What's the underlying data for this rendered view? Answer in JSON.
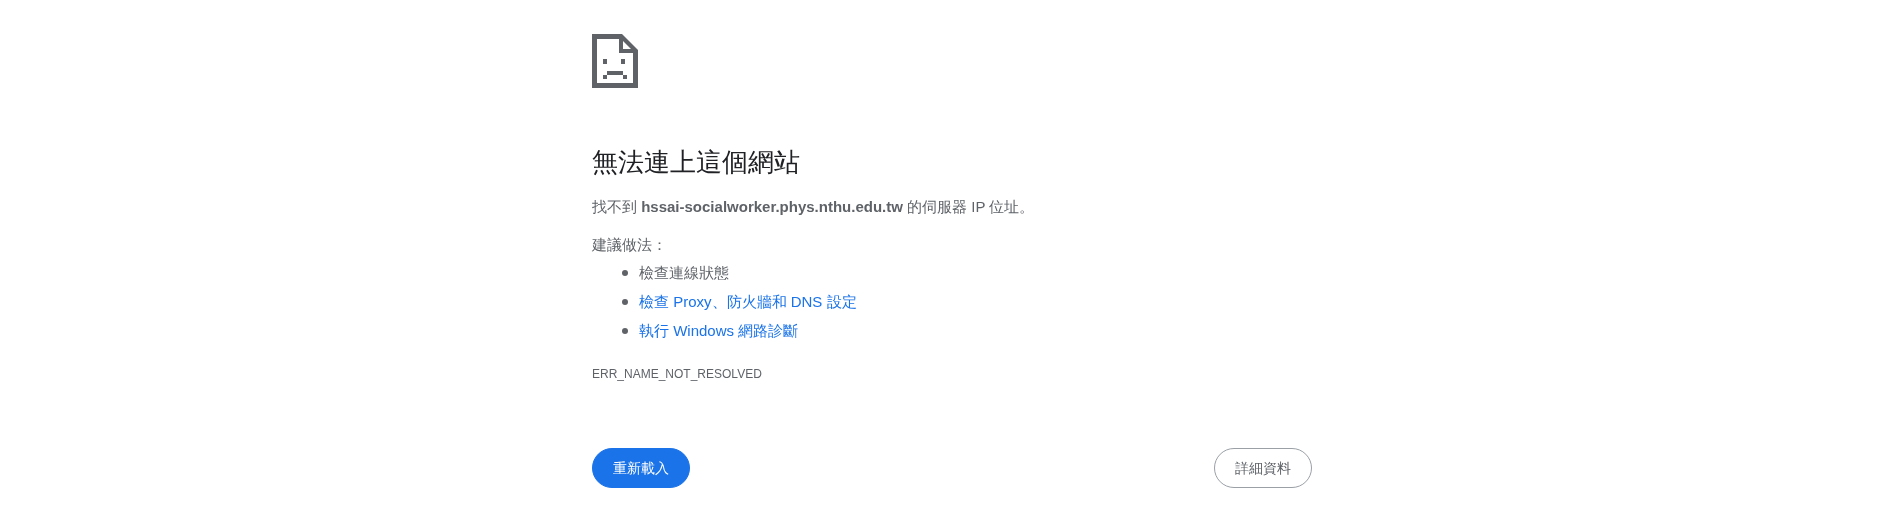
{
  "heading": "無法連上這個網站",
  "message": "找不到 **hssai-socialworker.phys.nthu.edu.tw** 的伺服器 IP 位址。",
  "suggestions_heading": "建議做法：",
  "suggestions": [
    {
      "kind": "text",
      "label": "檢查連線狀態"
    },
    {
      "kind": "link",
      "label": "檢查 Proxy、防火牆和 DNS 設定"
    },
    {
      "kind": "link",
      "label": "執行 Windows 網路診斷"
    }
  ],
  "error_code": "ERR_NAME_NOT_RESOLVED",
  "buttons": [
    {
      "kind": "primary",
      "label": "重新載入"
    },
    {
      "kind": "secondary",
      "label": "詳細資料"
    }
  ]
}
